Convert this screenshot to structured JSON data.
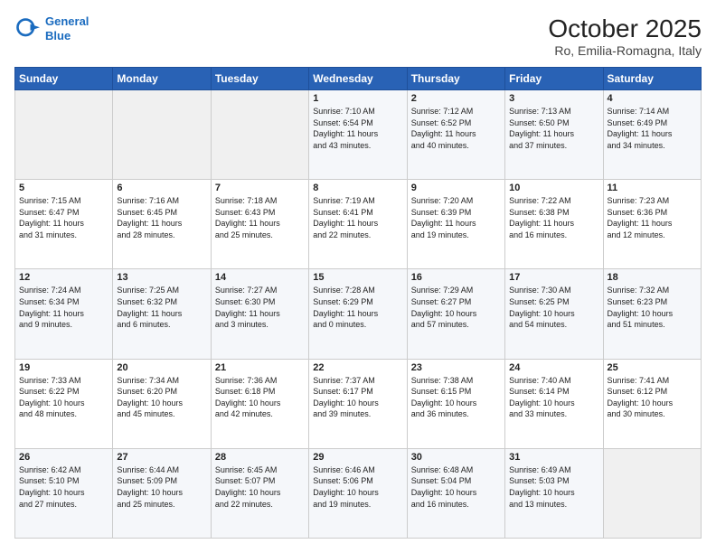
{
  "logo": {
    "line1": "General",
    "line2": "Blue"
  },
  "title": "October 2025",
  "subtitle": "Ro, Emilia-Romagna, Italy",
  "days_of_week": [
    "Sunday",
    "Monday",
    "Tuesday",
    "Wednesday",
    "Thursday",
    "Friday",
    "Saturday"
  ],
  "weeks": [
    [
      {
        "day": "",
        "content": ""
      },
      {
        "day": "",
        "content": ""
      },
      {
        "day": "",
        "content": ""
      },
      {
        "day": "1",
        "content": "Sunrise: 7:10 AM\nSunset: 6:54 PM\nDaylight: 11 hours\nand 43 minutes."
      },
      {
        "day": "2",
        "content": "Sunrise: 7:12 AM\nSunset: 6:52 PM\nDaylight: 11 hours\nand 40 minutes."
      },
      {
        "day": "3",
        "content": "Sunrise: 7:13 AM\nSunset: 6:50 PM\nDaylight: 11 hours\nand 37 minutes."
      },
      {
        "day": "4",
        "content": "Sunrise: 7:14 AM\nSunset: 6:49 PM\nDaylight: 11 hours\nand 34 minutes."
      }
    ],
    [
      {
        "day": "5",
        "content": "Sunrise: 7:15 AM\nSunset: 6:47 PM\nDaylight: 11 hours\nand 31 minutes."
      },
      {
        "day": "6",
        "content": "Sunrise: 7:16 AM\nSunset: 6:45 PM\nDaylight: 11 hours\nand 28 minutes."
      },
      {
        "day": "7",
        "content": "Sunrise: 7:18 AM\nSunset: 6:43 PM\nDaylight: 11 hours\nand 25 minutes."
      },
      {
        "day": "8",
        "content": "Sunrise: 7:19 AM\nSunset: 6:41 PM\nDaylight: 11 hours\nand 22 minutes."
      },
      {
        "day": "9",
        "content": "Sunrise: 7:20 AM\nSunset: 6:39 PM\nDaylight: 11 hours\nand 19 minutes."
      },
      {
        "day": "10",
        "content": "Sunrise: 7:22 AM\nSunset: 6:38 PM\nDaylight: 11 hours\nand 16 minutes."
      },
      {
        "day": "11",
        "content": "Sunrise: 7:23 AM\nSunset: 6:36 PM\nDaylight: 11 hours\nand 12 minutes."
      }
    ],
    [
      {
        "day": "12",
        "content": "Sunrise: 7:24 AM\nSunset: 6:34 PM\nDaylight: 11 hours\nand 9 minutes."
      },
      {
        "day": "13",
        "content": "Sunrise: 7:25 AM\nSunset: 6:32 PM\nDaylight: 11 hours\nand 6 minutes."
      },
      {
        "day": "14",
        "content": "Sunrise: 7:27 AM\nSunset: 6:30 PM\nDaylight: 11 hours\nand 3 minutes."
      },
      {
        "day": "15",
        "content": "Sunrise: 7:28 AM\nSunset: 6:29 PM\nDaylight: 11 hours\nand 0 minutes."
      },
      {
        "day": "16",
        "content": "Sunrise: 7:29 AM\nSunset: 6:27 PM\nDaylight: 10 hours\nand 57 minutes."
      },
      {
        "day": "17",
        "content": "Sunrise: 7:30 AM\nSunset: 6:25 PM\nDaylight: 10 hours\nand 54 minutes."
      },
      {
        "day": "18",
        "content": "Sunrise: 7:32 AM\nSunset: 6:23 PM\nDaylight: 10 hours\nand 51 minutes."
      }
    ],
    [
      {
        "day": "19",
        "content": "Sunrise: 7:33 AM\nSunset: 6:22 PM\nDaylight: 10 hours\nand 48 minutes."
      },
      {
        "day": "20",
        "content": "Sunrise: 7:34 AM\nSunset: 6:20 PM\nDaylight: 10 hours\nand 45 minutes."
      },
      {
        "day": "21",
        "content": "Sunrise: 7:36 AM\nSunset: 6:18 PM\nDaylight: 10 hours\nand 42 minutes."
      },
      {
        "day": "22",
        "content": "Sunrise: 7:37 AM\nSunset: 6:17 PM\nDaylight: 10 hours\nand 39 minutes."
      },
      {
        "day": "23",
        "content": "Sunrise: 7:38 AM\nSunset: 6:15 PM\nDaylight: 10 hours\nand 36 minutes."
      },
      {
        "day": "24",
        "content": "Sunrise: 7:40 AM\nSunset: 6:14 PM\nDaylight: 10 hours\nand 33 minutes."
      },
      {
        "day": "25",
        "content": "Sunrise: 7:41 AM\nSunset: 6:12 PM\nDaylight: 10 hours\nand 30 minutes."
      }
    ],
    [
      {
        "day": "26",
        "content": "Sunrise: 6:42 AM\nSunset: 5:10 PM\nDaylight: 10 hours\nand 27 minutes."
      },
      {
        "day": "27",
        "content": "Sunrise: 6:44 AM\nSunset: 5:09 PM\nDaylight: 10 hours\nand 25 minutes."
      },
      {
        "day": "28",
        "content": "Sunrise: 6:45 AM\nSunset: 5:07 PM\nDaylight: 10 hours\nand 22 minutes."
      },
      {
        "day": "29",
        "content": "Sunrise: 6:46 AM\nSunset: 5:06 PM\nDaylight: 10 hours\nand 19 minutes."
      },
      {
        "day": "30",
        "content": "Sunrise: 6:48 AM\nSunset: 5:04 PM\nDaylight: 10 hours\nand 16 minutes."
      },
      {
        "day": "31",
        "content": "Sunrise: 6:49 AM\nSunset: 5:03 PM\nDaylight: 10 hours\nand 13 minutes."
      },
      {
        "day": "",
        "content": ""
      }
    ]
  ]
}
